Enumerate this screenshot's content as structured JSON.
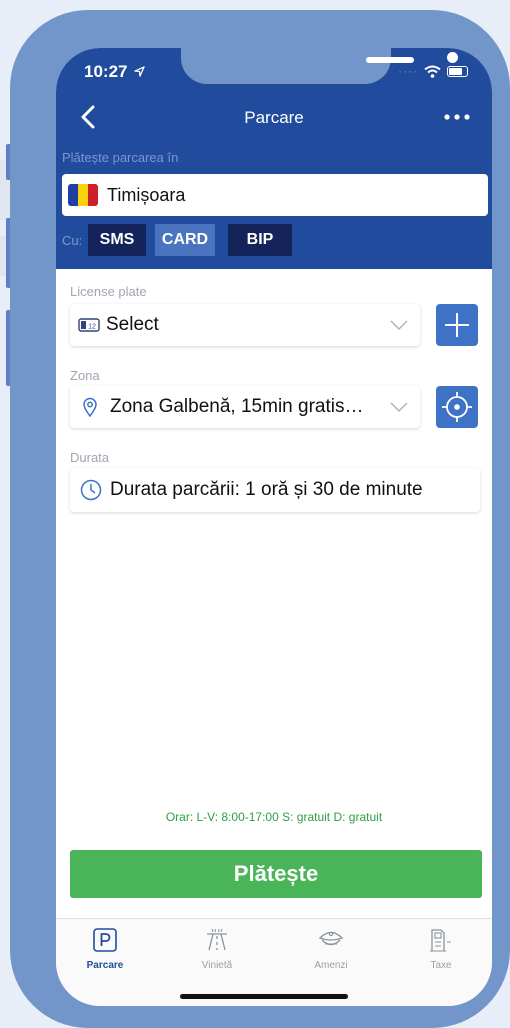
{
  "status": {
    "time": "10:27"
  },
  "nav": {
    "title": "Parcare"
  },
  "pay_in": {
    "label": "Plătește parcarea în",
    "city": "Timișoara"
  },
  "payment": {
    "label": "Cu:",
    "methods": [
      {
        "label": "SMS",
        "active": false
      },
      {
        "label": "CARD",
        "active": true
      },
      {
        "label": "BIP",
        "active": false
      }
    ]
  },
  "license": {
    "label": "License plate",
    "value": "Select"
  },
  "zone": {
    "label": "Zona",
    "value": "Zona Galbenă, 15min gratis…"
  },
  "duration": {
    "label": "Durata",
    "value": "Durata parcării: 1 oră și 30 de minute"
  },
  "schedule": "Orar: L-V: 8:00-17:00 S: gratuit D: gratuit",
  "pay_button": "Plătește",
  "tabs": [
    {
      "label": "Parcare",
      "icon": "parking-icon",
      "active": true
    },
    {
      "label": "Vinietă",
      "icon": "road-icon",
      "active": false
    },
    {
      "label": "Amenzi",
      "icon": "police-cap-icon",
      "active": false
    },
    {
      "label": "Taxe",
      "icon": "tax-document-icon",
      "active": false
    }
  ],
  "colors": {
    "header": "#214c9d",
    "accent": "#3d72c7",
    "pay": "#49b558",
    "phone_frame": "#7296ca"
  },
  "flag_colors": [
    "#1f3fa3",
    "#f8d20c",
    "#cf1f2c"
  ]
}
